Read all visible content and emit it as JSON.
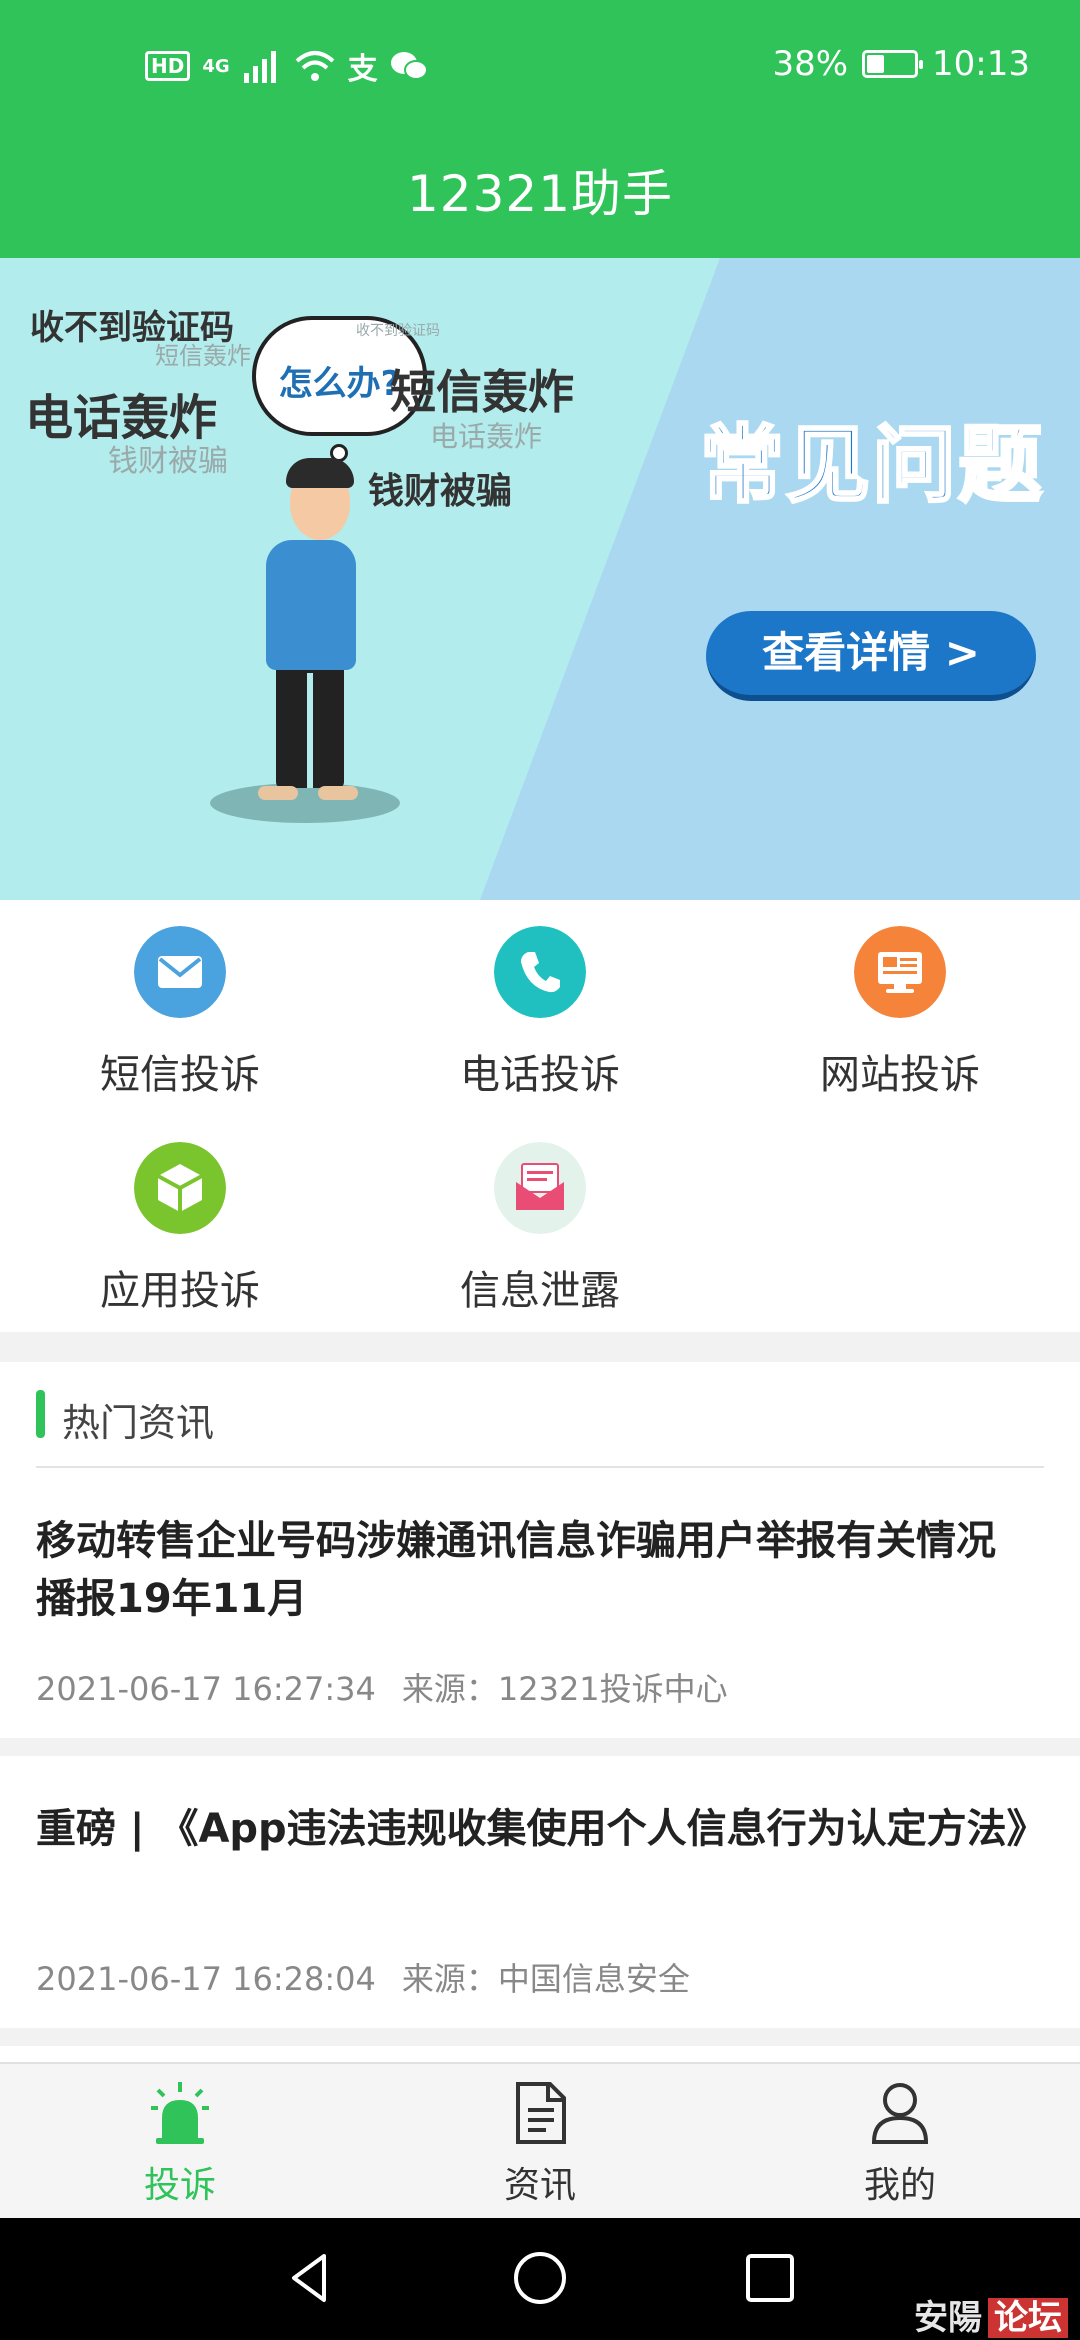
{
  "status_bar": {
    "left_indicators": [
      "HD",
      "4G"
    ],
    "battery_percent": "38%",
    "battery_level": 0.38,
    "time": "10:13"
  },
  "header": {
    "title": "12321助手"
  },
  "banner": {
    "bubble_text": "怎么办?",
    "words": [
      "收不到验证码",
      "短信轰炸",
      "电话轰炸",
      "钱财被骗",
      "短信轰炸",
      "电话轰炸",
      "钱财被骗",
      "收不到验证码"
    ],
    "faq_title": "常见问题",
    "details_button": "查看详情 >"
  },
  "services": [
    {
      "label": "短信投诉",
      "icon": "mail-icon",
      "color": "#4aa3df"
    },
    {
      "label": "电话投诉",
      "icon": "phone-icon",
      "color": "#20c0c0"
    },
    {
      "label": "网站投诉",
      "icon": "monitor-icon",
      "color": "#f5843a"
    },
    {
      "label": "应用投诉",
      "icon": "cube-icon",
      "color": "#7ac52d"
    },
    {
      "label": "信息泄露",
      "icon": "envelope-open-icon",
      "color": "#e94d75"
    }
  ],
  "news": {
    "heading": "热门资讯",
    "items": [
      {
        "title": "移动转售企业号码涉嫌通讯信息诈骗用户举报有关情况播报19年11月",
        "time": "2021-06-17 16:27:34",
        "source": "来源：12321投诉中心"
      },
      {
        "title": "重磅 | 《App违法违规收集使用个人信息行为认定方法》",
        "time": "2021-06-17 16:28:04",
        "source": "来源：中国信息安全"
      }
    ]
  },
  "tabs": [
    {
      "label": "投诉",
      "icon": "alarm-icon",
      "active": true
    },
    {
      "label": "资讯",
      "icon": "document-icon",
      "active": false
    },
    {
      "label": "我的",
      "icon": "user-icon",
      "active": false
    }
  ],
  "colors": {
    "brand": "#2fc35a",
    "banner_left": "#b3ecec",
    "banner_right": "#a9d8f0",
    "faq_blue": "#1d77c8"
  },
  "watermark": {
    "text": "安陽",
    "badge": "论坛"
  }
}
